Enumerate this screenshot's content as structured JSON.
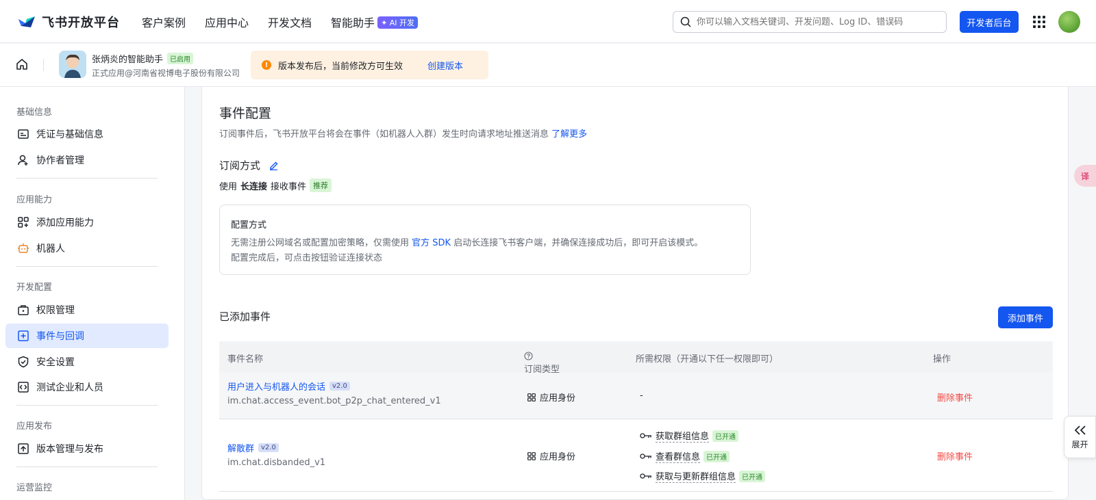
{
  "header": {
    "logo_text": "飞书开放平台",
    "nav": [
      "客户案例",
      "应用中心",
      "开发文档",
      "智能助手"
    ],
    "ai_badge": "✦ AI 开发",
    "search_placeholder": "你可以输入文档关键词、开发问题、Log ID、错误码",
    "dev_console": "开发者后台"
  },
  "app": {
    "name": "张炳炎的智能助手",
    "status": "已启用",
    "subtitle": "正式应用@河南省视博电子股份有限公司",
    "notice": "版本发布后，当前修改方可生效",
    "notice_link": "创建版本"
  },
  "sidebar": {
    "groups": [
      {
        "title": "基础信息",
        "items": [
          "凭证与基础信息",
          "协作者管理"
        ]
      },
      {
        "title": "应用能力",
        "items": [
          "添加应用能力",
          "机器人"
        ]
      },
      {
        "title": "开发配置",
        "items": [
          "权限管理",
          "事件与回调",
          "安全设置",
          "测试企业和人员"
        ]
      },
      {
        "title": "应用发布",
        "items": [
          "版本管理与发布"
        ]
      },
      {
        "title": "运营监控",
        "items": []
      }
    ],
    "active_item": "事件与回调"
  },
  "main": {
    "title": "事件配置",
    "desc": "订阅事件后，飞书开放平台将会在事件（如机器人入群）发生时向请求地址推送消息",
    "desc_link": "了解更多",
    "subscribe_title": "订阅方式",
    "mode_prefix": "使用",
    "mode_name": "长连接",
    "mode_suffix": "接收事件",
    "mode_badge": "推荐",
    "config": {
      "title": "配置方式",
      "line1_a": "无需注册公网域名或配置加密策略，仅需使用",
      "line1_link": "官方 SDK",
      "line1_b": "启动长连接飞书客户端，并确保连接成功后，即可开启该模式。",
      "line2": "配置完成后，可点击按钮验证连接状态"
    },
    "added_title": "已添加事件",
    "add_button": "添加事件",
    "table": {
      "headers": [
        "事件名称",
        "订阅类型",
        "所需权限（开通以下任一权限即可）",
        "操作"
      ],
      "rows": [
        {
          "name": "用户进入与机器人的会话",
          "version": "v2.0",
          "code": "im.chat.access_event.bot_p2p_chat_entered_v1",
          "type": "应用身份",
          "perms": [],
          "perm_empty": "-",
          "action": "删除事件"
        },
        {
          "name": "解散群",
          "version": "v2.0",
          "code": "im.chat.disbanded_v1",
          "type": "应用身份",
          "perms": [
            {
              "name": "获取群组信息",
              "status": "已开通"
            },
            {
              "name": "查看群信息",
              "status": "已开通"
            },
            {
              "name": "获取与更新群组信息",
              "status": "已开通"
            }
          ],
          "action": "删除事件"
        }
      ]
    }
  },
  "float": {
    "translate": "译",
    "expand": "展开"
  },
  "colors": {
    "primary": "#1456f0",
    "danger": "#f54a45",
    "active_bg": "#e1eaff",
    "notice_bg": "#fef1e1"
  }
}
